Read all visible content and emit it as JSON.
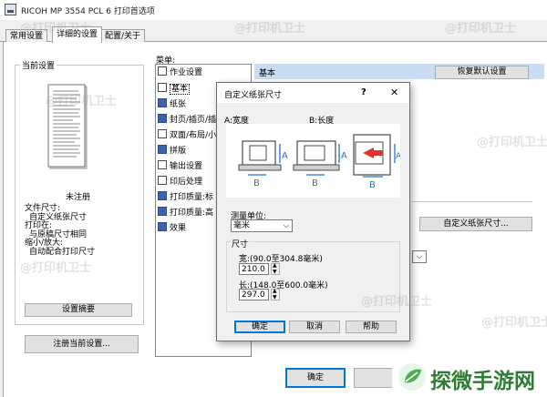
{
  "window": {
    "title": "RICOH MP 3554 PCL 6 打印首选项"
  },
  "tabs": [
    {
      "label": "常用设置"
    },
    {
      "label": "详细的设置"
    },
    {
      "label": "配置/关于"
    }
  ],
  "left_panel": {
    "group_label": "当前设置",
    "unregistered": "未注册",
    "summary_lines": [
      "文件尺寸:",
      "自定义纸张尺寸",
      "打印在:",
      "与原稿尺寸相同",
      "缩小/放大:",
      "自动配合打印尺寸"
    ],
    "settings_summary_button": "设置摘要",
    "register_button": "注册当前设置..."
  },
  "menu": {
    "label": "菜单:",
    "items": [
      "作业设置",
      "基本",
      "纸张",
      "封页/插页/插",
      "双面/布局/小",
      "拼版",
      "输出设置",
      "印后处理",
      "打印质量:标",
      "打印质量:高",
      "效果"
    ]
  },
  "right_panel": {
    "header": "基本",
    "restore_default_button": "恢复默认设置",
    "custom_paper_button": "自定义纸张尺寸..."
  },
  "dialog": {
    "title": "自定义纸张尺寸",
    "help_symbol": "?",
    "close_symbol": "✕",
    "label_a": "A:宽度",
    "label_b": "B:长度",
    "units_label": "测量单位:",
    "units_value": "毫米",
    "size_group": "尺寸",
    "width_label": "宽:(90.0至304.8毫米)",
    "width_value": "210.0",
    "length_label": "长:(148.0至600.0毫米)",
    "length_value": "297.0",
    "ok_button": "确定",
    "cancel_button": "取消",
    "help_button": "帮助",
    "fig_a": "A",
    "fig_b": "B"
  },
  "bottom": {
    "ok_button": "确定"
  },
  "watermark_text": "@打印机卫士",
  "brand": {
    "text": "探微手游网"
  },
  "colors": {
    "accent": "#0078d7",
    "header_bg": "#c9ddf2",
    "diagram_blue": "#1f73d6",
    "arrow_red": "#e0332c",
    "brand_green": "#4caf50"
  },
  "icons": [
    "printer-app-icon",
    "document-preview-icon",
    "tree-item-icon",
    "help-icon",
    "close-icon",
    "dropdown-arrow-icon",
    "spin-up-icon",
    "spin-down-icon",
    "paper-feed-diagram-icon",
    "brand-logo-icon"
  ]
}
